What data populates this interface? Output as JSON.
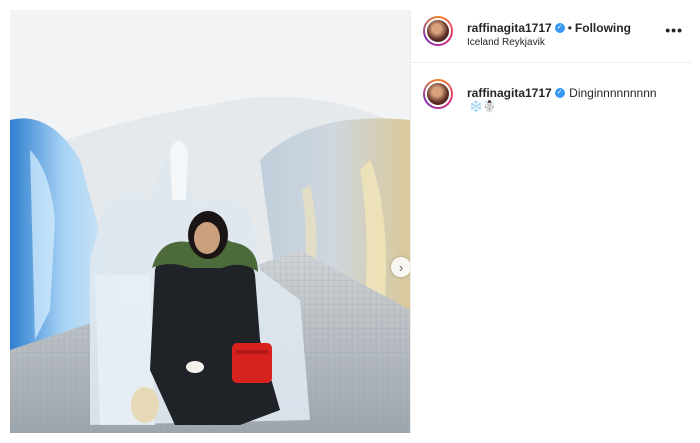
{
  "post": {
    "username": "raffinagita1717",
    "verified_icon": "verified-badge-icon",
    "separator": "•",
    "follow_status": "Following",
    "location": "Iceland Reykjavik",
    "more_icon": "more-options-icon",
    "more_label": "•••"
  },
  "caption": {
    "username": "raffinagita1717",
    "text": "Dinginnnnnnnnn",
    "emojis": "❄️☃️"
  },
  "carousel": {
    "next_icon": "chevron-right-icon",
    "next_label": "›"
  },
  "colors": {
    "verified": "#3897f0",
    "text": "#262626",
    "divider": "#efefef"
  }
}
